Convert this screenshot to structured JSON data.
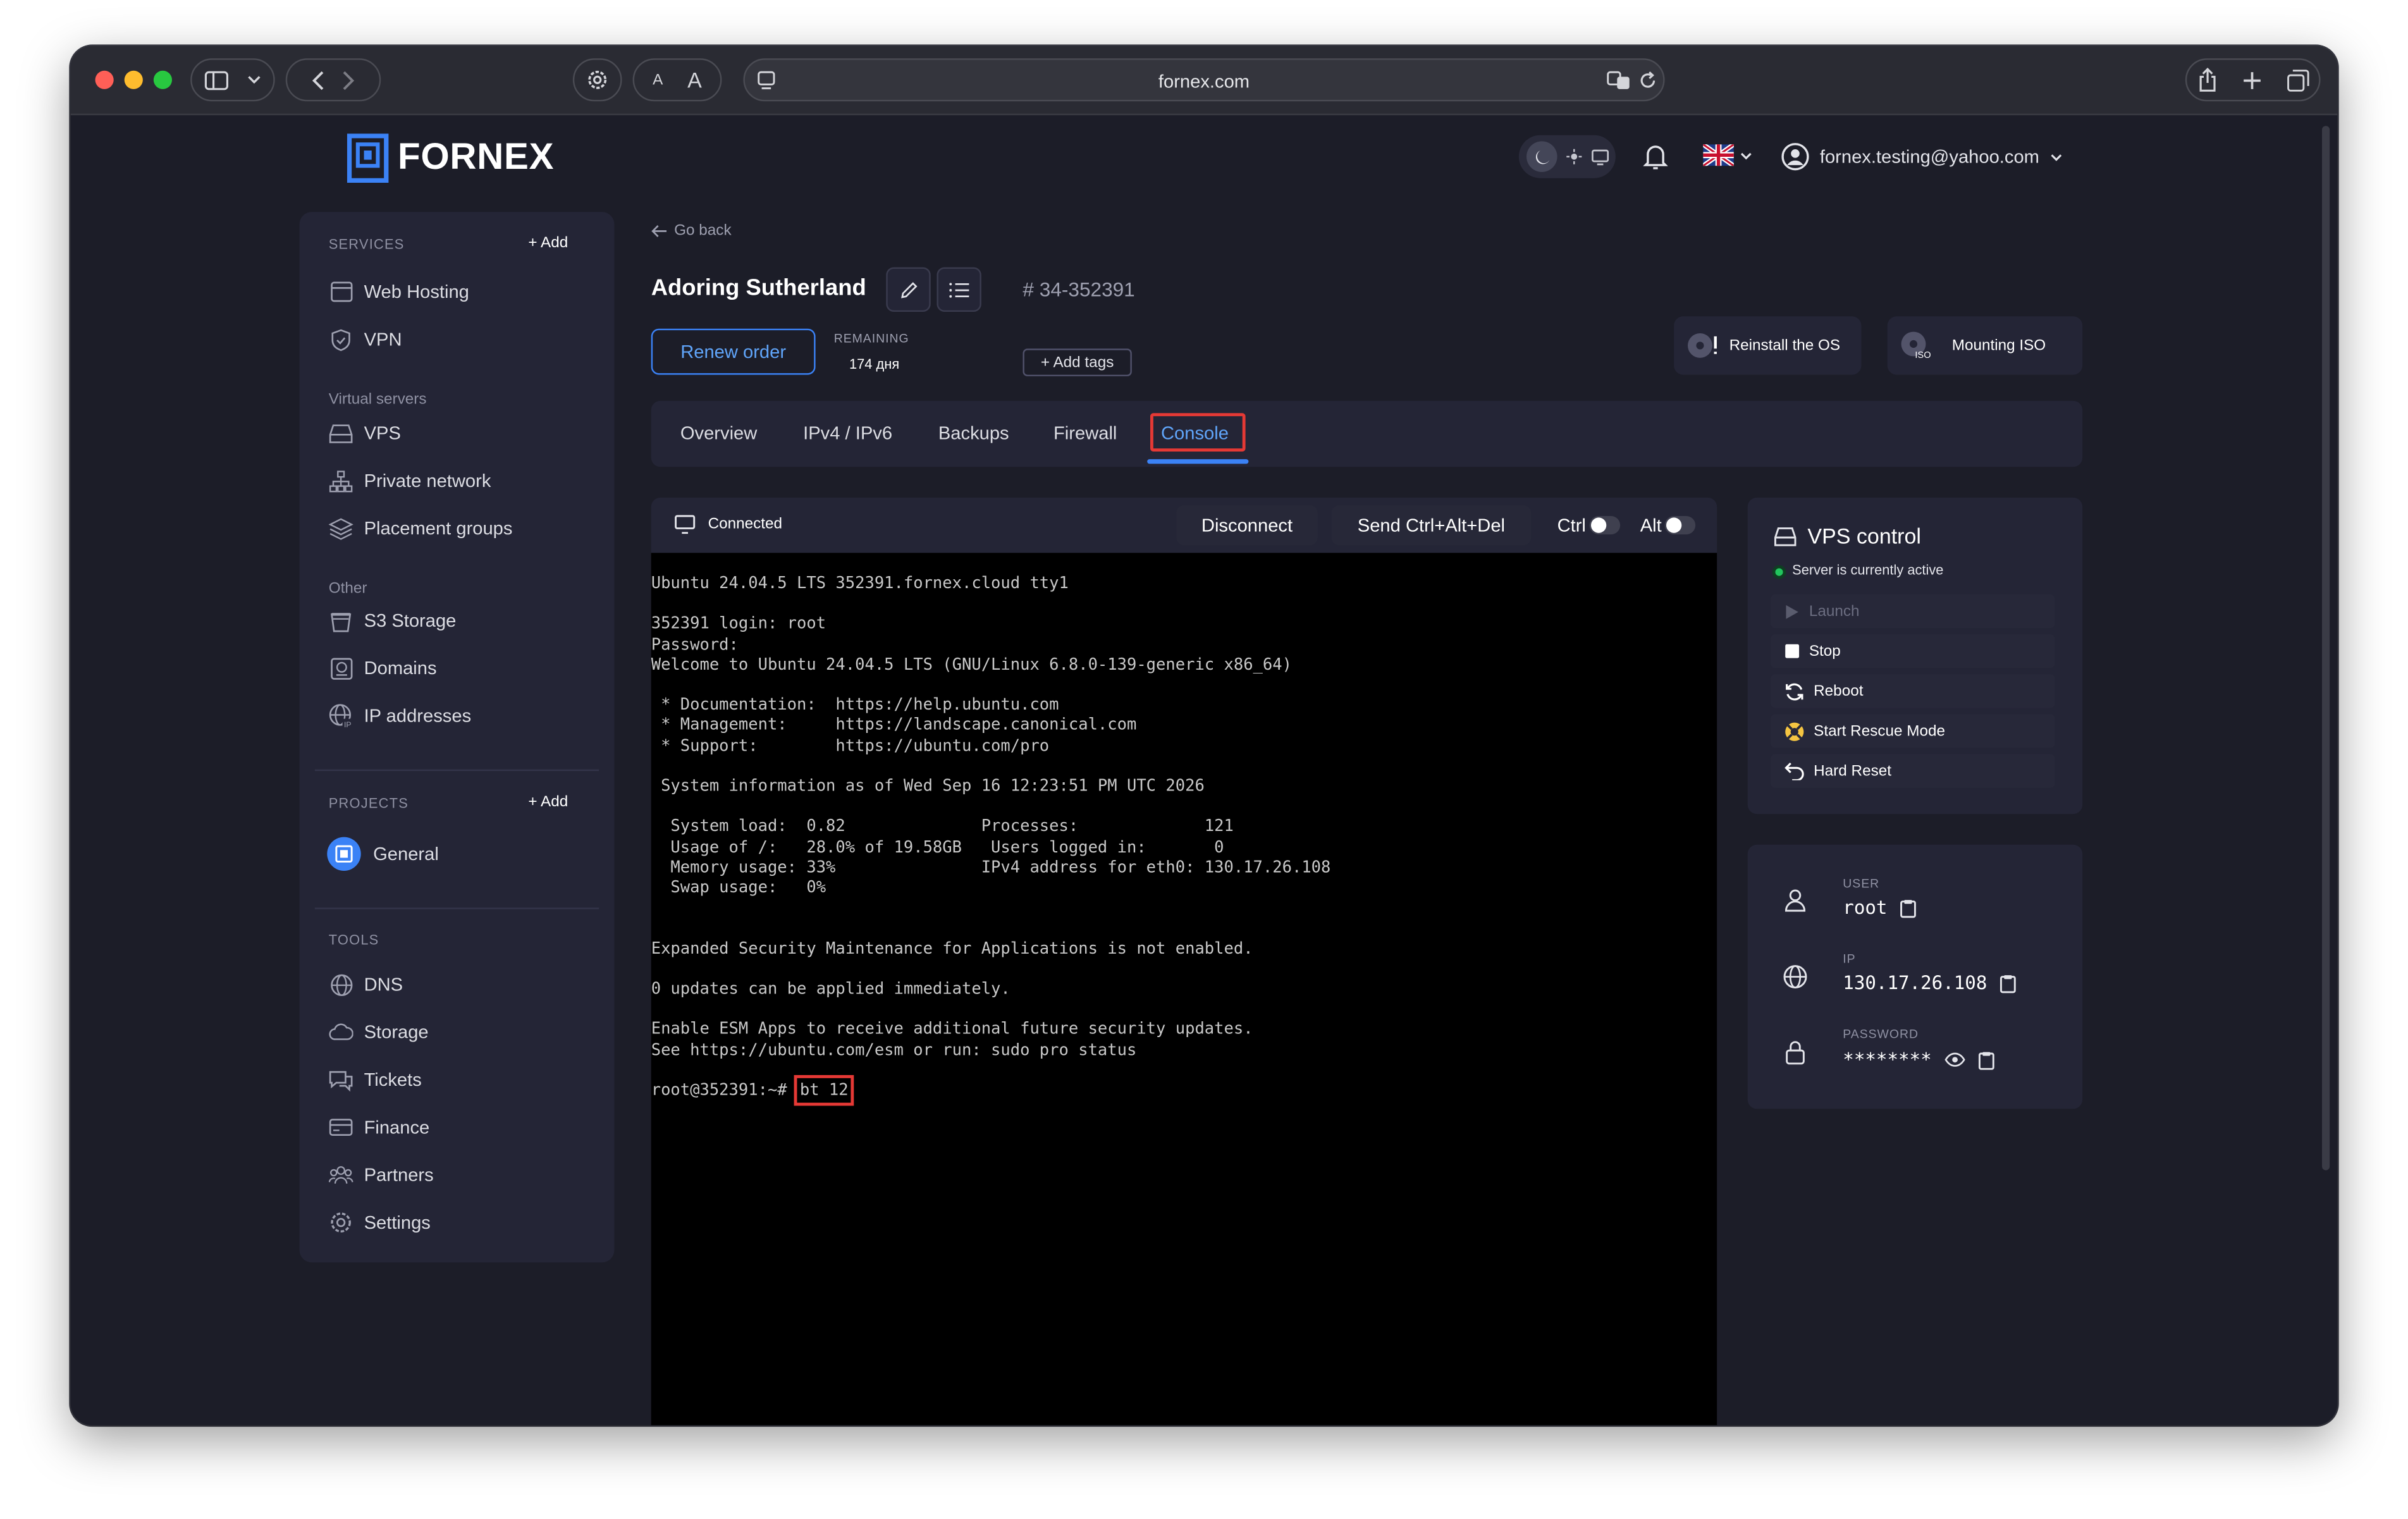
{
  "browser": {
    "url": "fornex.com",
    "font_small_label": "A",
    "font_large_label": "A"
  },
  "header": {
    "logo_text": "FORNEX",
    "user_email": "fornex.testing@yahoo.com"
  },
  "sidebar": {
    "services_label": "SERVICES",
    "services_add": "+ Add",
    "services": [
      {
        "label": "Web Hosting",
        "icon": "browser-window-icon"
      },
      {
        "label": "VPN",
        "icon": "shield-icon"
      }
    ],
    "virtual_servers_label": "Virtual servers",
    "virtual_servers": [
      {
        "label": "VPS",
        "icon": "server-drive-icon"
      },
      {
        "label": "Private network",
        "icon": "network-icon"
      },
      {
        "label": "Placement groups",
        "icon": "layers-icon"
      }
    ],
    "other_label": "Other",
    "other": [
      {
        "label": "S3 Storage",
        "icon": "bucket-icon"
      },
      {
        "label": "Domains",
        "icon": "domain-icon"
      },
      {
        "label": "IP addresses",
        "icon": "ip-globe-icon"
      }
    ],
    "projects_label": "PROJECTS",
    "projects_add": "+ Add",
    "project_general": "General",
    "tools_label": "TOOLS",
    "tools": [
      {
        "label": "DNS",
        "icon": "globe-icon"
      },
      {
        "label": "Storage",
        "icon": "cloud-icon"
      },
      {
        "label": "Tickets",
        "icon": "chat-icon"
      },
      {
        "label": "Finance",
        "icon": "card-icon"
      },
      {
        "label": "Partners",
        "icon": "people-icon"
      },
      {
        "label": "Settings",
        "icon": "gear-icon"
      }
    ]
  },
  "page": {
    "go_back": "Go back",
    "server_name": "Adoring Sutherland",
    "server_id": "# 34-352391",
    "renew_label": "Renew order",
    "remaining_label": "REMAINING",
    "remaining_value": "174 дня",
    "add_tags": "+ Add tags",
    "reinstall_os": "Reinstall the OS",
    "mounting_iso": "Mounting ISO",
    "iso_badge": "ISO"
  },
  "tabs": [
    {
      "label": "Overview"
    },
    {
      "label": "IPv4 / IPv6"
    },
    {
      "label": "Backups"
    },
    {
      "label": "Firewall"
    },
    {
      "label": "Console"
    }
  ],
  "console": {
    "status": "Connected",
    "disconnect": "Disconnect",
    "send_cad": "Send Ctrl+Alt+Del",
    "ctrl_label": "Ctrl",
    "alt_label": "Alt",
    "output": "Ubuntu 24.04.5 LTS 352391.fornex.cloud tty1\n\n352391 login: root\nPassword:\nWelcome to Ubuntu 24.04.5 LTS (GNU/Linux 6.8.0-139-generic x86_64)\n\n * Documentation:  https://help.ubuntu.com\n * Management:     https://landscape.canonical.com\n * Support:        https://ubuntu.com/pro\n\n System information as of Wed Sep 16 12:23:51 PM UTC 2026\n\n  System load:  0.82              Processes:             121\n  Usage of /:   28.0% of 19.58GB   Users logged in:       0\n  Memory usage: 33%               IPv4 address for eth0: 130.17.26.108\n  Swap usage:   0%\n\n\nExpanded Security Maintenance for Applications is not enabled.\n\n0 updates can be applied immediately.\n\nEnable ESM Apps to receive additional future security updates.\nSee https://ubuntu.com/esm or run: sudo pro status\n\n",
    "prompt": "root@352391:~# ",
    "command": "bt 12"
  },
  "vps_control": {
    "title": "VPS control",
    "status": "Server is currently active",
    "status_color": "#22c55e",
    "actions": [
      {
        "label": "Launch",
        "icon": "play-icon",
        "enabled": false
      },
      {
        "label": "Stop",
        "icon": "stop-icon",
        "enabled": true
      },
      {
        "label": "Reboot",
        "icon": "reboot-icon",
        "enabled": true
      },
      {
        "label": "Start Rescue Mode",
        "icon": "lifebuoy-icon",
        "enabled": true
      },
      {
        "label": "Hard Reset",
        "icon": "undo-icon",
        "enabled": true
      }
    ]
  },
  "credentials": {
    "user_label": "USER",
    "user_value": "root",
    "ip_label": "IP",
    "ip_value": "130.17.26.108",
    "password_label": "PASSWORD",
    "password_value": "********"
  },
  "colors": {
    "accent": "#3b82f6",
    "highlight_box": "#e53935",
    "background": "#1c1d28",
    "panel": "#242536"
  }
}
